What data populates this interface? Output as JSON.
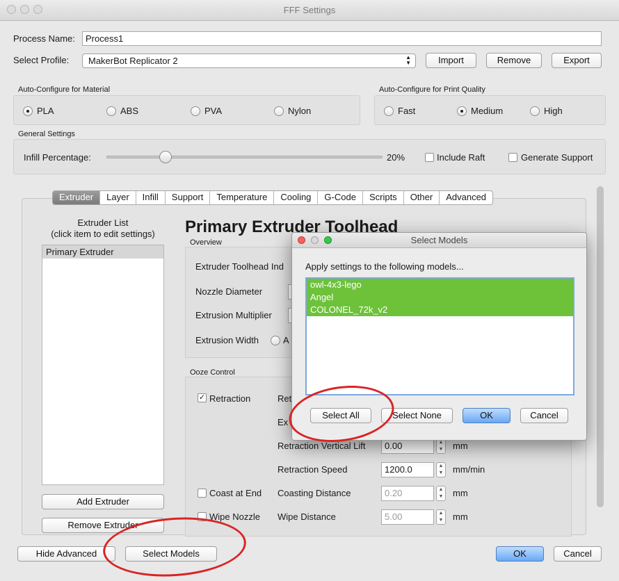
{
  "window": {
    "title": "FFF Settings"
  },
  "process": {
    "label": "Process Name:",
    "value": "Process1"
  },
  "profile": {
    "label": "Select Profile:",
    "value": "MakerBot Replicator 2",
    "import": "Import",
    "remove": "Remove",
    "export": "Export"
  },
  "material": {
    "title": "Auto-Configure for Material",
    "options": [
      "PLA",
      "ABS",
      "PVA",
      "Nylon"
    ],
    "selected": "PLA"
  },
  "quality": {
    "title": "Auto-Configure for Print Quality",
    "options": [
      "Fast",
      "Medium",
      "High"
    ],
    "selected": "Medium"
  },
  "general": {
    "title": "General Settings",
    "infill_label": "Infill Percentage:",
    "infill_value": "20%",
    "infill_fraction": 0.2,
    "raft": "Include Raft",
    "support": "Generate Support"
  },
  "tabs": [
    "Extruder",
    "Layer",
    "Infill",
    "Support",
    "Temperature",
    "Cooling",
    "G-Code",
    "Scripts",
    "Other",
    "Advanced"
  ],
  "active_tab": "Extruder",
  "extruder_list": {
    "title_line1": "Extruder List",
    "title_line2": "(click item to edit settings)",
    "items": [
      "Primary Extruder"
    ],
    "add": "Add Extruder",
    "remove": "Remove Extruder"
  },
  "toolhead": {
    "heading": "Primary Extruder Toolhead",
    "overview": "Overview",
    "toolhead_index": "Extruder Toolhead Ind",
    "nozzle": "Nozzle Diameter",
    "multiplier": "Extrusion Multiplier",
    "width": "Extrusion Width",
    "width_opt": "A"
  },
  "ooze": {
    "title": "Ooze Control",
    "retraction": "Retraction",
    "retraction_partial": "Ret",
    "extra_partial": "Ex",
    "vertical_lift": "Retraction Vertical Lift",
    "vertical_lift_value": "0.00",
    "speed": "Retraction Speed",
    "speed_value": "1200.0",
    "coast": "Coast at End",
    "coast_dist": "Coasting Distance",
    "coast_value": "0.20",
    "wipe": "Wipe Nozzle",
    "wipe_dist": "Wipe Distance",
    "wipe_value": "5.00",
    "unit_mm": "mm",
    "unit_mm_min": "mm/min"
  },
  "footer": {
    "hide_advanced": "Hide Advanced",
    "select_models": "Select Models",
    "ok": "OK",
    "cancel": "Cancel"
  },
  "dialog": {
    "title": "Select Models",
    "prompt": "Apply settings to the following models...",
    "models": [
      "owl-4x3-lego",
      "Angel",
      "COLONEL_72k_v2"
    ],
    "select_all": "Select All",
    "select_none": "Select None",
    "ok": "OK",
    "cancel": "Cancel"
  },
  "colors": {
    "selection": "#6dc23a",
    "default_button": "#6aa8f4",
    "annotation": "#d92424"
  }
}
